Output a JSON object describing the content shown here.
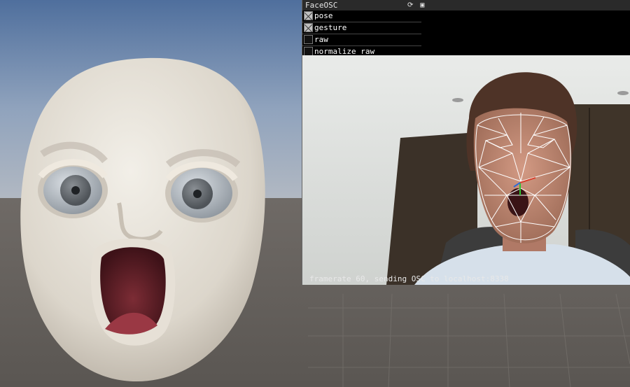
{
  "window": {
    "title": "FaceOSC"
  },
  "toggles": [
    {
      "label": "pose",
      "checked": true
    },
    {
      "label": "gesture",
      "checked": true
    },
    {
      "label": "raw",
      "checked": false
    },
    {
      "label": "normalize raw",
      "checked": false
    }
  ],
  "status": {
    "text": "framerate 60, sending OSC to localhost:8338"
  },
  "icons": {
    "refresh": "refresh-icon",
    "save": "save-icon"
  }
}
